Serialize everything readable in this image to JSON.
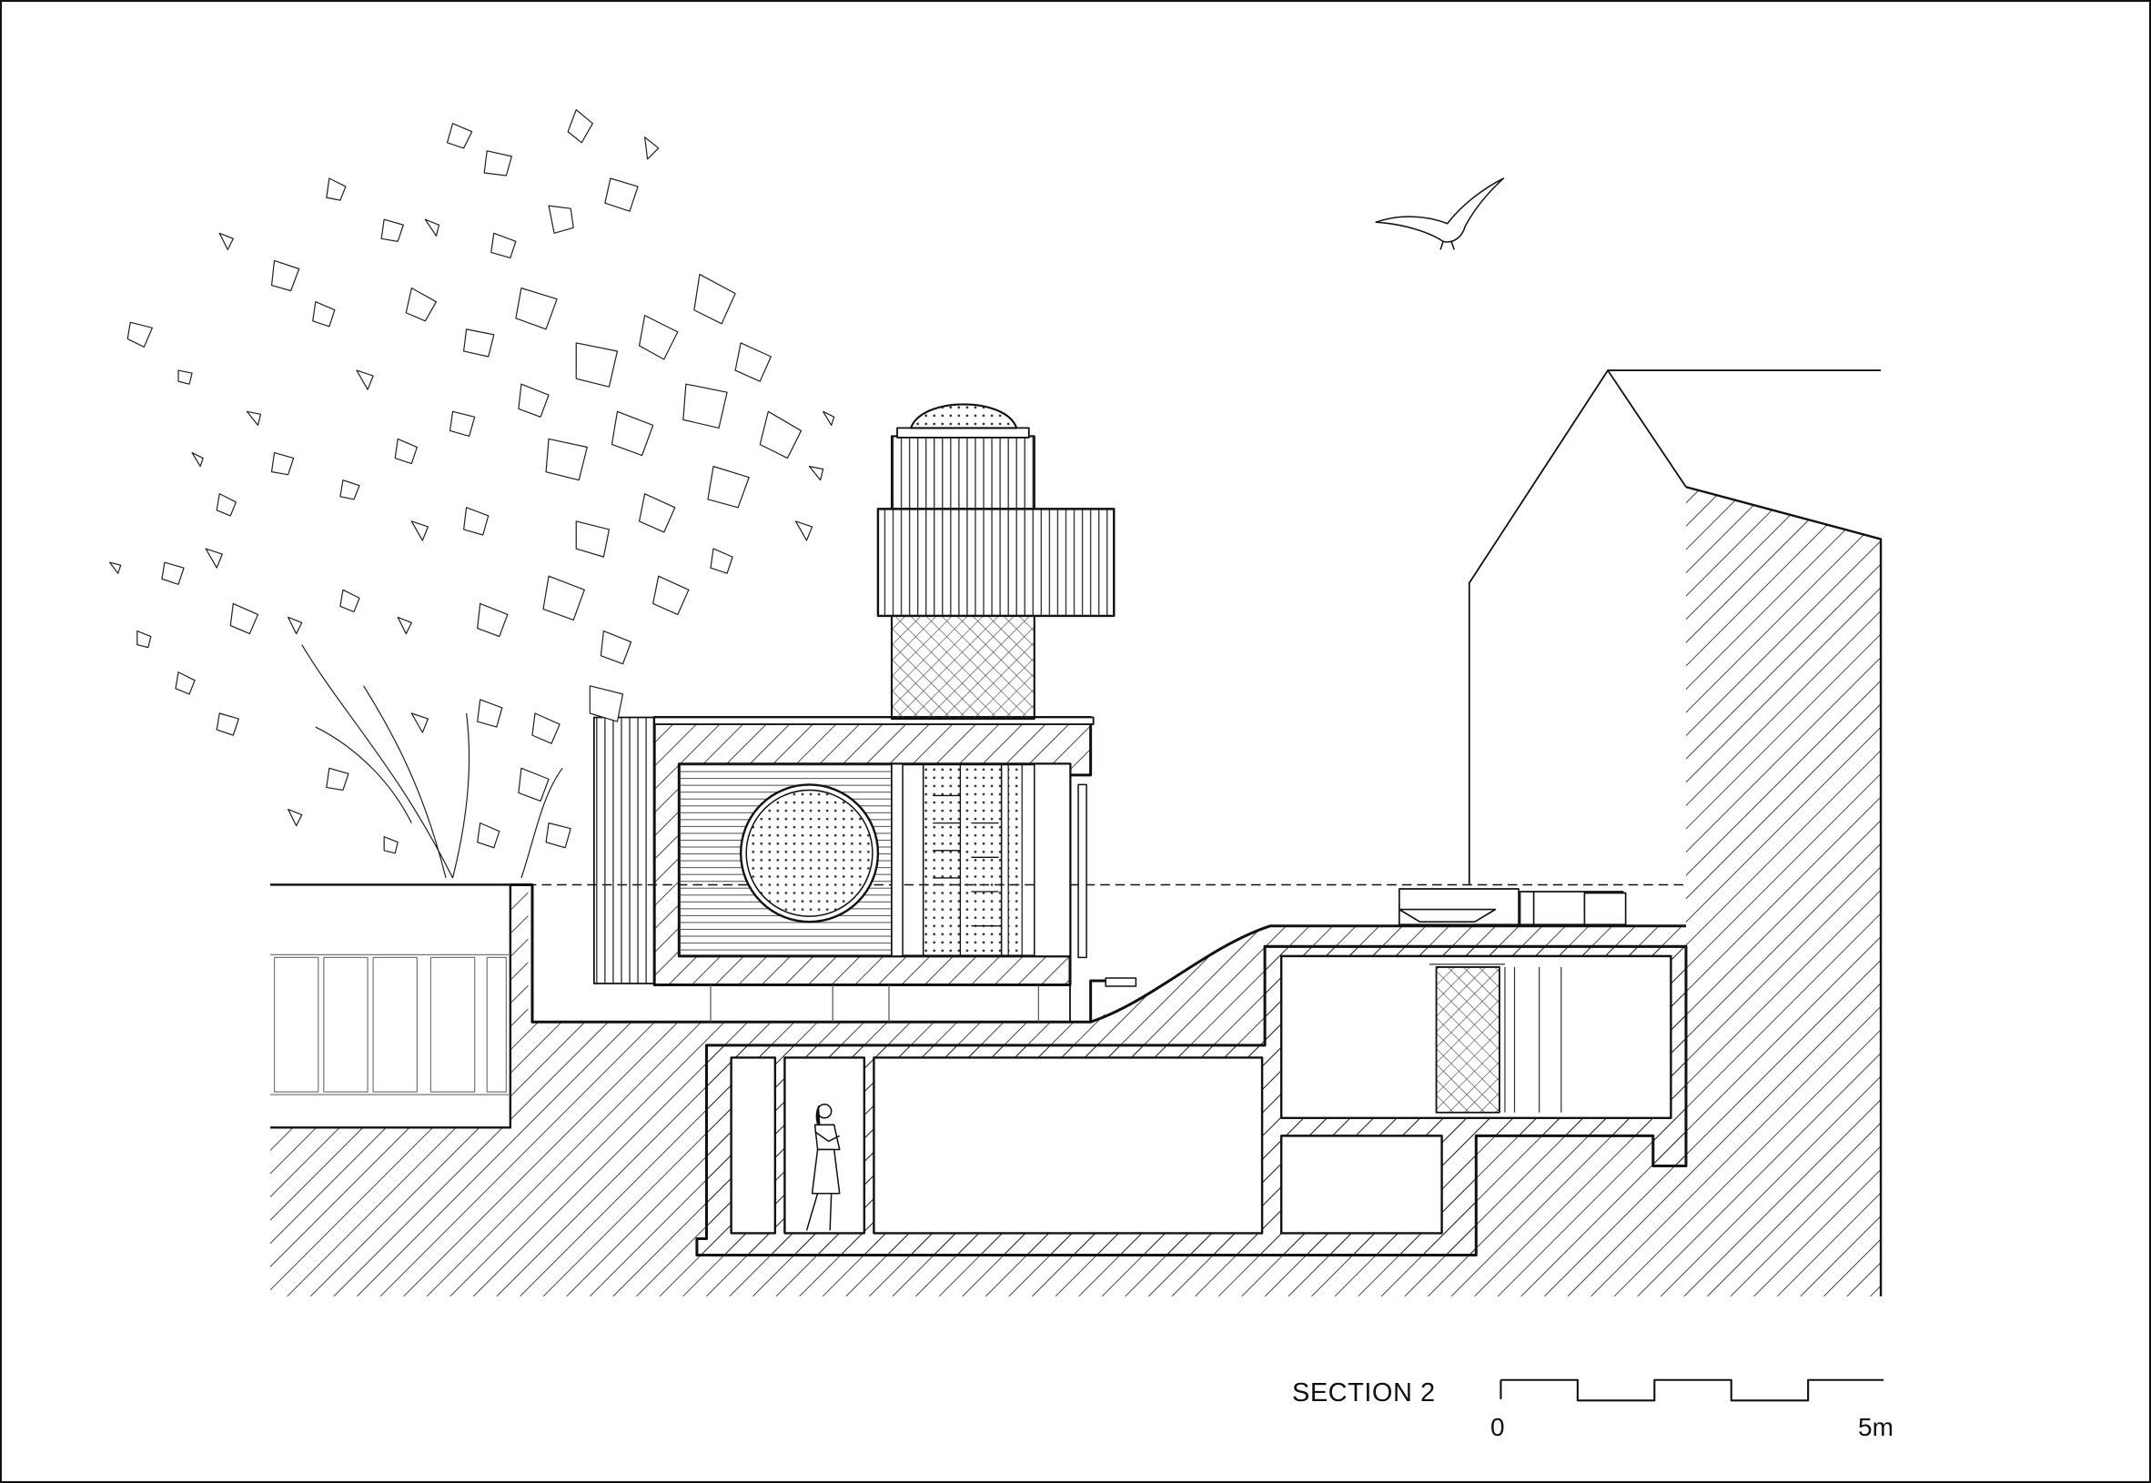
{
  "drawing": {
    "title": "SECTION 2",
    "scale_bar": {
      "start_label": "0",
      "end_label": "5m",
      "length_m": 5,
      "segments": 5
    }
  },
  "figures": [
    "tree",
    "seagull",
    "person",
    "neighbouring-house",
    "pavilion-with-tower"
  ]
}
